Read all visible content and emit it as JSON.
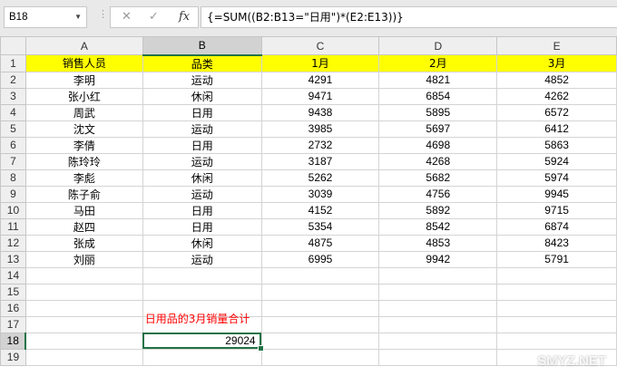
{
  "formula_bar": {
    "name_box": "B18",
    "dots": "⋮",
    "cancel_icon": "✕",
    "enter_icon": "✓",
    "fx_label": "fx",
    "formula": "{=SUM((B2:B13=\"日用\")*(E2:E13))}"
  },
  "columns": [
    "A",
    "B",
    "C",
    "D",
    "E"
  ],
  "rows": [
    {
      "n": "1",
      "cells": [
        "销售人员",
        "品类",
        "1月",
        "2月",
        "3月"
      ]
    },
    {
      "n": "2",
      "cells": [
        "李明",
        "运动",
        "4291",
        "4821",
        "4852"
      ]
    },
    {
      "n": "3",
      "cells": [
        "张小红",
        "休闲",
        "9471",
        "6854",
        "4262"
      ]
    },
    {
      "n": "4",
      "cells": [
        "周武",
        "日用",
        "9438",
        "5895",
        "6572"
      ]
    },
    {
      "n": "5",
      "cells": [
        "沈文",
        "运动",
        "3985",
        "5697",
        "6412"
      ]
    },
    {
      "n": "6",
      "cells": [
        "李倩",
        "日用",
        "2732",
        "4698",
        "5863"
      ]
    },
    {
      "n": "7",
      "cells": [
        "陈玲玲",
        "运动",
        "3187",
        "4268",
        "5924"
      ]
    },
    {
      "n": "8",
      "cells": [
        "李彪",
        "休闲",
        "5262",
        "5682",
        "5974"
      ]
    },
    {
      "n": "9",
      "cells": [
        "陈子俞",
        "运动",
        "3039",
        "4756",
        "9945"
      ]
    },
    {
      "n": "10",
      "cells": [
        "马田",
        "日用",
        "4152",
        "5892",
        "9715"
      ]
    },
    {
      "n": "11",
      "cells": [
        "赵四",
        "日用",
        "5354",
        "8542",
        "6874"
      ]
    },
    {
      "n": "12",
      "cells": [
        "张成",
        "休闲",
        "4875",
        "4853",
        "8423"
      ]
    },
    {
      "n": "13",
      "cells": [
        "刘丽",
        "运动",
        "6995",
        "9942",
        "5791"
      ]
    }
  ],
  "empty_rows": [
    "14",
    "15",
    "16"
  ],
  "row17": {
    "n": "17",
    "note": "日用品的3月销量合计"
  },
  "row18": {
    "n": "18",
    "value": "29024"
  },
  "row19": {
    "n": "19"
  },
  "watermark": "SMYZ.NET",
  "colors": {
    "header_fill": "#ffff00",
    "note_text": "#ff0000",
    "selection": "#217346"
  }
}
